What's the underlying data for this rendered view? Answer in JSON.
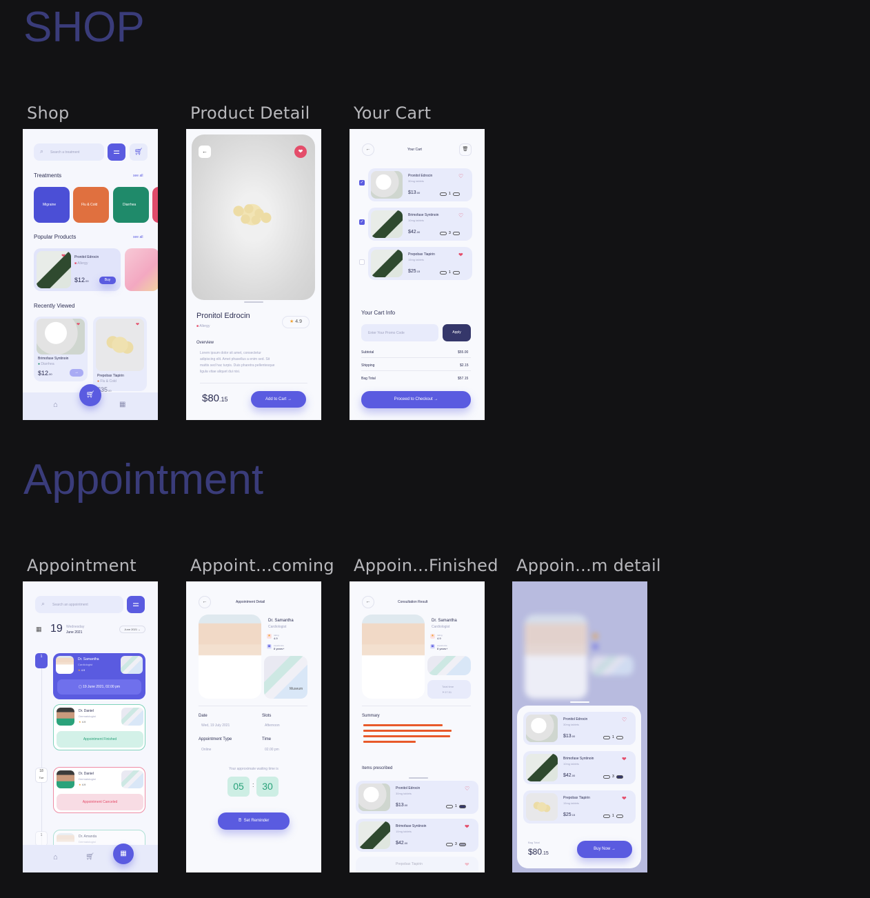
{
  "sections": {
    "shop": "SHOP",
    "appointment": "Appointment"
  },
  "frame_labels": {
    "shop": "Shop",
    "product_detail": "Product Detail",
    "your_cart": "Your Cart",
    "appointment": "Appointment",
    "appointment_upcoming": "Appoint...coming",
    "appointment_finished": "Appoin...Finished",
    "appointment_detail": "Appoin...m detail"
  },
  "shop": {
    "search_placeholder": "Search a treatment",
    "treatments_title": "Treatments",
    "see_all": "see all",
    "treatments": [
      "Migraine",
      "Flu & Cold",
      "Diarrhea"
    ],
    "treatment_colors": [
      "#4b4fd6",
      "#e0703f",
      "#1f8a6a",
      "#e04b6b"
    ],
    "popular_title": "Popular Products",
    "popular": {
      "name": "Pronitol Edrocin",
      "category": "Allergy",
      "price": "$12",
      "cents": ".00",
      "buy": "Buy"
    },
    "recent_title": "Recently Viewed",
    "recent": [
      {
        "name": "Brimofase Syntinoin",
        "category": "Diarrhea",
        "price": "$12",
        "cents": ".00"
      },
      {
        "name": "Prepobax Tiapirin",
        "category": "Flu & Cold",
        "price": "$35",
        "cents": ".00"
      }
    ]
  },
  "product": {
    "name": "Pronitol Edrocin",
    "category": "Allergy",
    "rating": "4.9",
    "overview_title": "Overview",
    "overview": [
      "Lorem ipsum dolor sit amet, consectetur",
      "adipiscing elit. Amet phasellus a enim sed. Sit",
      "mattis sed hac turpis. Duis pharetra pellentesque",
      "ligula vitae aliquet dui nisi."
    ],
    "price": "$80",
    "cents": ".15",
    "add_to_cart": "Add to Cart →"
  },
  "cart": {
    "title": "Your Cart",
    "items": [
      {
        "name": "Pronitol Edrocin",
        "dose": "30mg tablets",
        "price": "$13",
        "cents": ".00",
        "qty": "1"
      },
      {
        "name": "Brimofase Syntinoin",
        "dose": "10mg tablets",
        "price": "$42",
        "cents": ".00",
        "qty": "3"
      },
      {
        "name": "Prepobax Tiapirin",
        "dose": "15mg tablets",
        "price": "$25",
        "cents": ".15",
        "qty": "1"
      }
    ],
    "info_title": "Your Cart Info",
    "promo_placeholder": "Enter Your Promo Code",
    "apply": "Apply",
    "subtotal_label": "Subtotal",
    "subtotal": "$55.00",
    "shipping_label": "Shipping",
    "shipping": "$2.15",
    "bag_total_label": "Bag Total",
    "bag_total": "$57.15",
    "checkout": "Proceed to Checkout →"
  },
  "appointment": {
    "search_placeholder": "Search an appointment",
    "day": "19",
    "weekday": "Wednesday",
    "month": "June 2021",
    "month_select": "June 2021 ⌄",
    "items": [
      {
        "date": "1",
        "name": "Dr. Samantha",
        "spec": "Cardiologist",
        "rating": "4.9",
        "when": "19 June 2021, 02.00 pm"
      },
      {
        "name": "Dr. Daniel",
        "spec": "Dermatologist",
        "rating": "4.9",
        "status": "Appointment Finished"
      },
      {
        "date": "18",
        "dow": "Tue",
        "name": "Dr. Daniel",
        "spec": "Dermatologist",
        "rating": "4.9",
        "status": "Appointment Canceled"
      },
      {
        "date": "1",
        "name": "Dr. Amanda",
        "spec": "Dermatologist"
      }
    ]
  },
  "upcoming": {
    "title": "Appointment Detail",
    "doctor": "Dr. Samantha",
    "spec": "Cardiologist",
    "rating_label": "rating",
    "rating": "4.9",
    "exp_label": "experience",
    "exp": "8 years+",
    "map_label": "Museum",
    "date_label": "Date",
    "date": "Wed, 19 July 2021",
    "slots_label": "Slots",
    "slots": "Afternoon",
    "type_label": "Appointment Type",
    "type": "Online",
    "time_label": "Time",
    "time": "02.00 pm",
    "wait_label": "Your approximate waiting time is",
    "wait_min": "05",
    "wait_sec": "30",
    "reminder": "Set Reminder"
  },
  "finished": {
    "title": "Consultation Result",
    "doctor": "Dr. Samantha",
    "spec": "Cardiologist",
    "rating_label": "rating",
    "rating": "4.9",
    "exp_label": "experience",
    "exp": "8 years+",
    "total_time_label": "Total time",
    "total_time": "07.51",
    "summary_title": "Summary",
    "items_title": "Items prescribed",
    "items": [
      {
        "name": "Pronitol Edrocin",
        "dose": "30mg tablets",
        "price": "$13",
        "cents": ".00",
        "qty": "1"
      },
      {
        "name": "Brimofase Syntinoin",
        "dose": "10mg tablets",
        "price": "$42",
        "cents": ".00",
        "qty": "3"
      },
      {
        "name": "Prepobax Tiapirin"
      }
    ]
  },
  "detail": {
    "items": [
      {
        "name": "Pronitol Edrocin",
        "dose": "30mg tablets",
        "price": "$13",
        "cents": ".00",
        "qty": "1"
      },
      {
        "name": "Brimofase Syntinoin",
        "dose": "10mg tablets",
        "price": "$42",
        "cents": ".00",
        "qty": "3"
      },
      {
        "name": "Prepobax Tiapirin",
        "dose": "15mg tablets",
        "price": "$25",
        "cents": ".15",
        "qty": "1"
      }
    ],
    "bag_total_label": "Bag Total",
    "price": "$80",
    "cents": ".15",
    "buy_now": "Buy Now →"
  }
}
